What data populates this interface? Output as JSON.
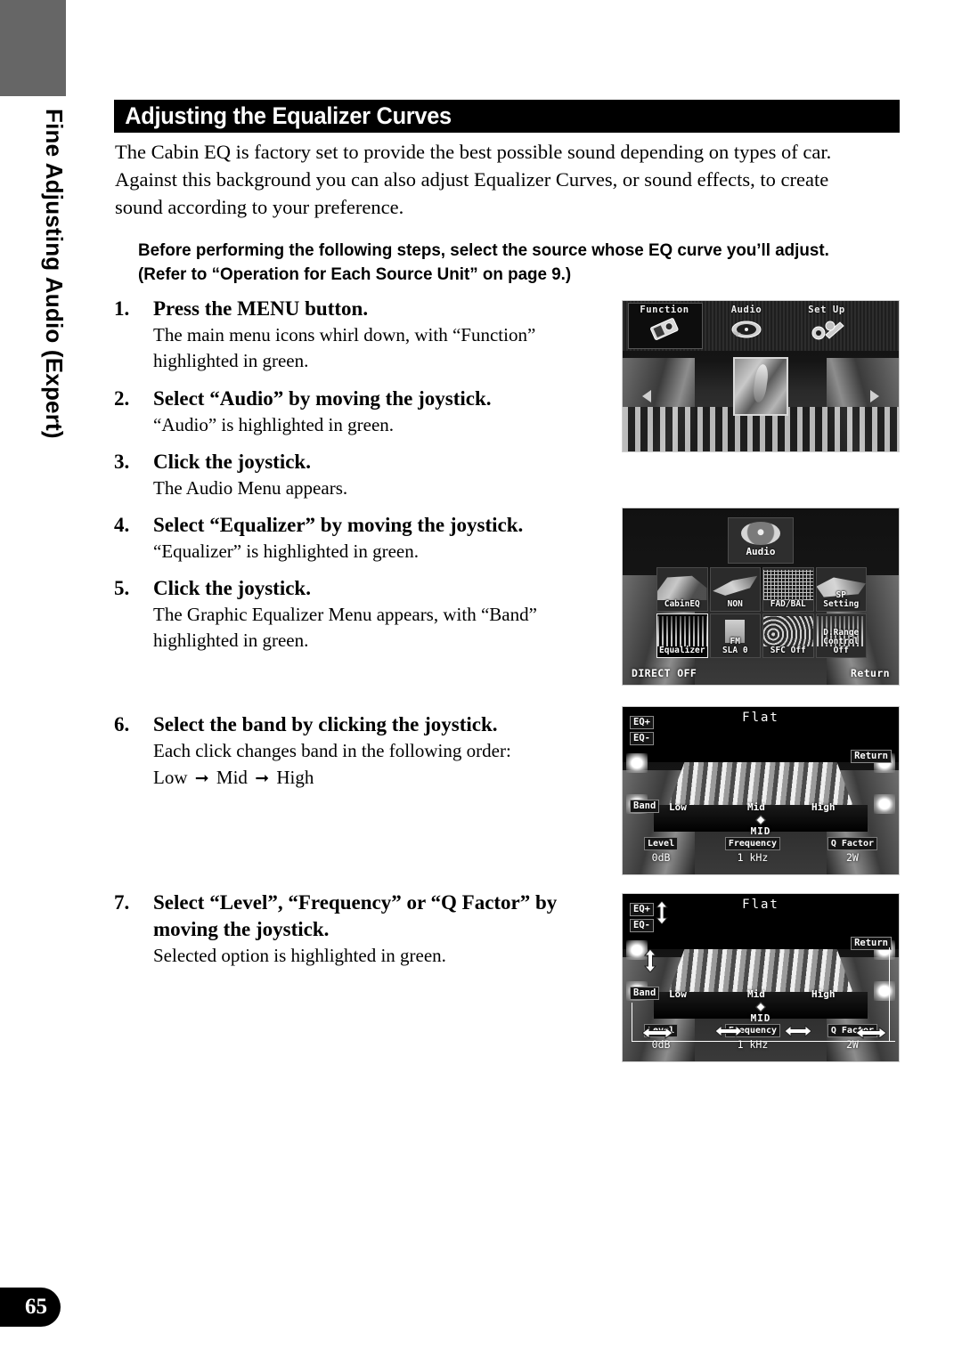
{
  "document": {
    "side_tab_label": "Fine Adjusting Audio (Expert)",
    "page_number": "65"
  },
  "header": {
    "title": "Adjusting the Equalizer Curves"
  },
  "intro": {
    "paragraph": "The Cabin EQ is factory set to provide the best possible sound depending on types of car. Against this background you can also adjust Equalizer Curves, or sound effects, to create sound according to your preference."
  },
  "note": {
    "line1": "Before performing the following steps, select the source whose EQ curve you’ll adjust.",
    "line2": "(Refer to “Operation for Each Source Unit” on page 9.)"
  },
  "steps": [
    {
      "number": "1.",
      "title": "Press the MENU button.",
      "body": "The main menu icons whirl down, with “Function” highlighted in green."
    },
    {
      "number": "2.",
      "title": "Select “Audio” by moving the joystick.",
      "body": "“Audio” is highlighted in green."
    },
    {
      "number": "3.",
      "title": "Click the joystick.",
      "body": "The Audio Menu appears."
    },
    {
      "number": "4.",
      "title": "Select “Equalizer” by moving the joystick.",
      "body": "“Equalizer” is highlighted in green."
    },
    {
      "number": "5.",
      "title": "Click the joystick.",
      "body": "The Graphic Equalizer Menu appears, with “Band” highlighted in green."
    },
    {
      "number": "6.",
      "title": "Select the band by clicking the joystick.",
      "body": "Each click changes band in the following order:",
      "order_low": "Low",
      "order_mid": "Mid",
      "order_high": "High"
    },
    {
      "number": "7.",
      "title": "Select “Level”, “Frequency” or “Q Factor” by moving the joystick.",
      "body": "Selected option is highlighted in green."
    }
  ],
  "screenshots": {
    "main_menu": {
      "items": [
        {
          "label": "Function",
          "icon": "remote-control-icon",
          "selected": true
        },
        {
          "label": "Audio",
          "icon": "speaker-disc-icon",
          "selected": false
        },
        {
          "label": "Set Up",
          "icon": "tools-icon",
          "selected": false
        }
      ]
    },
    "audio_menu": {
      "header_label": "Audio",
      "cells": [
        {
          "label": "CabinEQ",
          "icon": "car-cabin-icon",
          "selected": false
        },
        {
          "label": "NON",
          "icon": "loudness-icon",
          "selected": false
        },
        {
          "label": "FAD/BAL",
          "icon": "fader-balance-icon",
          "selected": false
        },
        {
          "label": "SP Setting",
          "icon": "speaker-setting-icon",
          "selected": false
        },
        {
          "label": "Equalizer",
          "icon": "equalizer-bars-icon",
          "selected": true
        },
        {
          "label": "FM\nSLA  0",
          "icon": "source-level-icon",
          "selected": false
        },
        {
          "label": "SFC Off",
          "icon": "sfc-icon",
          "selected": false
        },
        {
          "label": "D.Range\nControl\nOff",
          "icon": "dynamic-range-icon",
          "selected": false
        }
      ],
      "footer_left": "DIRECT OFF",
      "footer_right": "Return"
    },
    "graphic_eq": {
      "title": "Flat",
      "eq_plus": "EQ+",
      "eq_minus": "EQ-",
      "band_tag": "Band",
      "return_tag": "Return",
      "bands": [
        "Low",
        "Mid",
        "High"
      ],
      "current_band": "MID",
      "params": [
        {
          "name": "Level",
          "value": "0dB"
        },
        {
          "name": "Frequency",
          "value": "1 kHz"
        },
        {
          "name": "Q Factor",
          "value": "2W"
        }
      ]
    }
  },
  "colors": {
    "accent_black": "#000000",
    "corner_gray": "#666666",
    "paper": "#ffffff"
  }
}
